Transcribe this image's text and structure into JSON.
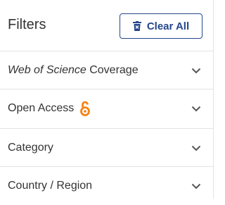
{
  "filters": {
    "title": "Filters",
    "clear_all_label": "Clear All",
    "items": [
      {
        "label_italic": "Web of Science",
        "label": " Coverage"
      },
      {
        "label": "Open Access"
      },
      {
        "label": "Category"
      },
      {
        "label": "Country / Region"
      }
    ]
  },
  "colors": {
    "primary": "#24478c",
    "open_access": "#f68212",
    "text": "#333333",
    "divider": "#e3e3e3"
  },
  "icons": {
    "clear": "trash-icon",
    "open_access": "open-access-icon",
    "expand": "chevron-down-icon"
  }
}
